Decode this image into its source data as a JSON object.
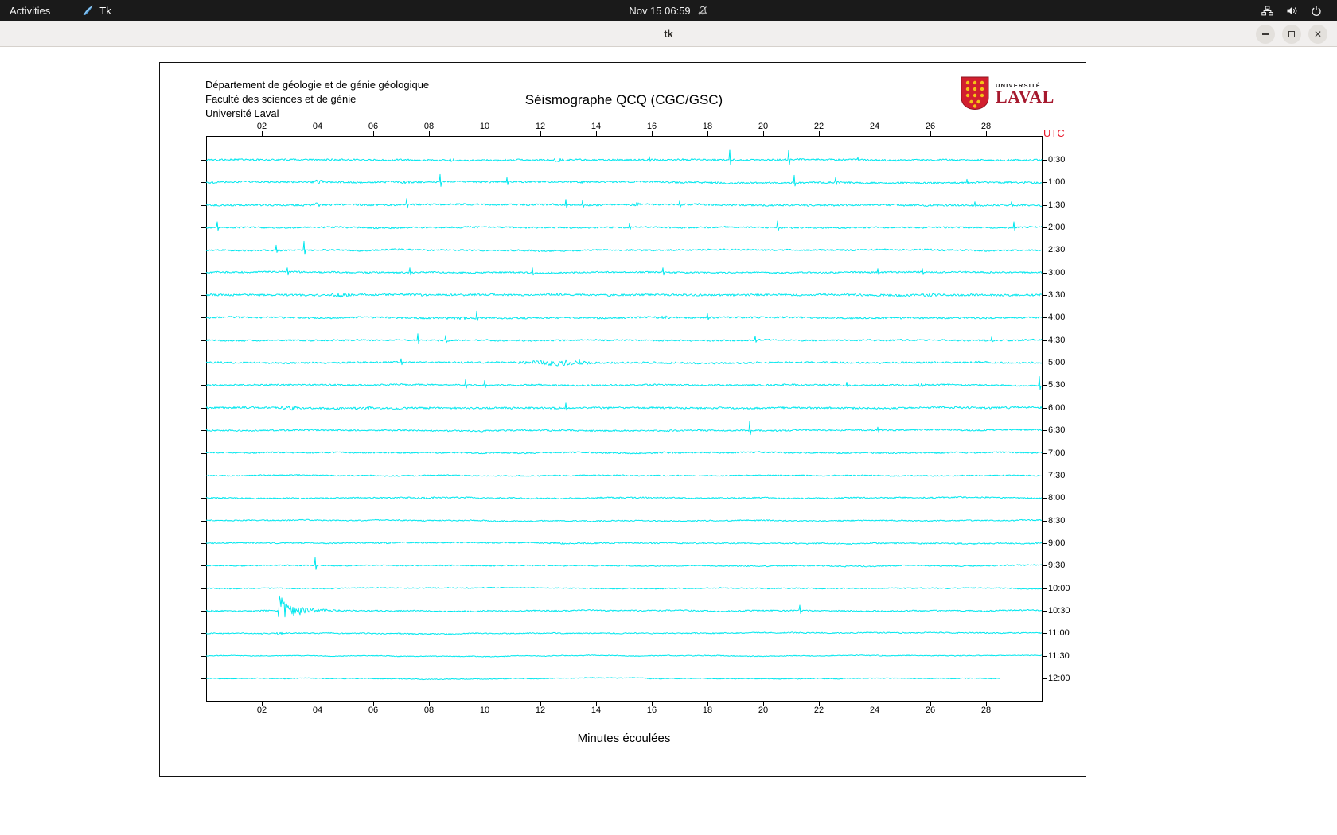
{
  "topbar": {
    "activities": "Activities",
    "app_name": "Tk",
    "clock": "Nov 15  06:59"
  },
  "titlebar": {
    "title": "tk"
  },
  "plot_header": {
    "line1": "Département de géologie et de génie géologique",
    "line2": "Faculté des sciences et de génie",
    "line3": "Université Laval"
  },
  "logo": {
    "small": "UNIVERSITÉ",
    "big": "LAVAL"
  },
  "colors": {
    "trace": "#00e7ee",
    "utc_red": "#e8192c",
    "logo_red": "#d21f2e",
    "logo_gold": "#f3c317"
  },
  "chart_data": {
    "type": "line",
    "title": "Séismographe QCQ (CGC/GSC)",
    "x_label": "Minutes écoulées",
    "utc_label": "UTC",
    "x_range": [
      0,
      30
    ],
    "minute_ticks": [
      "02",
      "04",
      "06",
      "08",
      "10",
      "12",
      "14",
      "16",
      "18",
      "20",
      "22",
      "24",
      "26",
      "28"
    ],
    "rows": [
      {
        "label": "0:30",
        "noise": 1.1,
        "events": [
          {
            "type": "blob",
            "t": 8.9,
            "a": 2,
            "w": 0.4
          },
          {
            "type": "blob",
            "t": 12.6,
            "a": 2.6,
            "w": 0.5
          },
          {
            "type": "spike",
            "t": 15.9,
            "a": 4
          },
          {
            "type": "spike",
            "t": 18.8,
            "a": 13
          },
          {
            "type": "spike",
            "t": 20.9,
            "a": 12
          },
          {
            "type": "spike",
            "t": 23.4,
            "a": 3
          }
        ]
      },
      {
        "label": "1:00",
        "noise": 1.1,
        "events": [
          {
            "type": "blob",
            "t": 4.0,
            "a": 2.6,
            "w": 0.5
          },
          {
            "type": "blob",
            "t": 7.2,
            "a": 2.6,
            "w": 0.4
          },
          {
            "type": "spike",
            "t": 8.4,
            "a": 10
          },
          {
            "type": "spike",
            "t": 10.8,
            "a": 6
          },
          {
            "type": "blob",
            "t": 13.5,
            "a": 2.4,
            "w": 0.3
          },
          {
            "type": "spike",
            "t": 21.1,
            "a": 9
          },
          {
            "type": "spike",
            "t": 22.6,
            "a": 6
          },
          {
            "type": "spike",
            "t": 27.3,
            "a": 4
          }
        ]
      },
      {
        "label": "1:30",
        "noise": 1.1,
        "events": [
          {
            "type": "blob",
            "t": 4.0,
            "a": 2.6,
            "w": 0.4
          },
          {
            "type": "spike",
            "t": 7.2,
            "a": 8
          },
          {
            "type": "spike",
            "t": 12.9,
            "a": 7
          },
          {
            "type": "spike",
            "t": 13.5,
            "a": 6
          },
          {
            "type": "blob",
            "t": 15.4,
            "a": 2.6,
            "w": 0.5
          },
          {
            "type": "spike",
            "t": 17.0,
            "a": 5
          },
          {
            "type": "spike",
            "t": 27.6,
            "a": 4
          },
          {
            "type": "spike",
            "t": 28.9,
            "a": 4
          }
        ]
      },
      {
        "label": "2:00",
        "noise": 1.0,
        "events": [
          {
            "type": "spike",
            "t": 0.4,
            "a": 7
          },
          {
            "type": "spike",
            "t": 15.2,
            "a": 5
          },
          {
            "type": "spike",
            "t": 20.5,
            "a": 8
          },
          {
            "type": "spike",
            "t": 29.0,
            "a": 7
          }
        ]
      },
      {
        "label": "2:30",
        "noise": 1.0,
        "events": [
          {
            "type": "spike",
            "t": 2.5,
            "a": 6
          },
          {
            "type": "spike",
            "t": 3.5,
            "a": 11
          }
        ]
      },
      {
        "label": "3:00",
        "noise": 1.0,
        "events": [
          {
            "type": "spike",
            "t": 2.9,
            "a": 6
          },
          {
            "type": "spike",
            "t": 7.3,
            "a": 6
          },
          {
            "type": "spike",
            "t": 11.7,
            "a": 6
          },
          {
            "type": "spike",
            "t": 16.4,
            "a": 6
          },
          {
            "type": "spike",
            "t": 24.1,
            "a": 5
          },
          {
            "type": "spike",
            "t": 25.7,
            "a": 5
          }
        ]
      },
      {
        "label": "3:30",
        "noise": 1.3,
        "events": [
          {
            "type": "blob",
            "t": 4.9,
            "a": 3,
            "w": 0.7
          },
          {
            "type": "blob",
            "t": 25.9,
            "a": 2.6,
            "w": 0.5
          }
        ]
      },
      {
        "label": "4:00",
        "noise": 1.1,
        "events": [
          {
            "type": "blob",
            "t": 9.0,
            "a": 2,
            "w": 1.2
          },
          {
            "type": "spike",
            "t": 9.7,
            "a": 8
          },
          {
            "type": "blob",
            "t": 16.5,
            "a": 2,
            "w": 1.0
          },
          {
            "type": "spike",
            "t": 18.0,
            "a": 5
          }
        ]
      },
      {
        "label": "4:30",
        "noise": 1.0,
        "events": [
          {
            "type": "spike",
            "t": 7.6,
            "a": 8
          },
          {
            "type": "spike",
            "t": 8.6,
            "a": 6
          },
          {
            "type": "spike",
            "t": 19.7,
            "a": 5
          },
          {
            "type": "spike",
            "t": 28.2,
            "a": 4
          }
        ]
      },
      {
        "label": "5:00",
        "noise": 1.1,
        "events": [
          {
            "type": "spike",
            "t": 7.0,
            "a": 5
          },
          {
            "type": "blob",
            "t": 12.6,
            "a": 3.5,
            "w": 2.4
          },
          {
            "type": "spike",
            "t": 13.4,
            "a": 4
          }
        ]
      },
      {
        "label": "5:30",
        "noise": 1.0,
        "events": [
          {
            "type": "spike",
            "t": 9.3,
            "a": 7
          },
          {
            "type": "spike",
            "t": 10.0,
            "a": 6
          },
          {
            "type": "spike",
            "t": 23.0,
            "a": 4
          },
          {
            "type": "blob",
            "t": 25.7,
            "a": 2.5,
            "w": 0.4
          },
          {
            "type": "spike",
            "t": 29.9,
            "a": 11
          }
        ]
      },
      {
        "label": "6:00",
        "noise": 1.2,
        "events": [
          {
            "type": "blob",
            "t": 3.0,
            "a": 3.5,
            "w": 0.5
          },
          {
            "type": "blob",
            "t": 5.8,
            "a": 2.5,
            "w": 0.3
          },
          {
            "type": "spike",
            "t": 12.9,
            "a": 6
          }
        ]
      },
      {
        "label": "6:30",
        "noise": 0.9,
        "events": [
          {
            "type": "spike",
            "t": 19.5,
            "a": 11
          },
          {
            "type": "spike",
            "t": 24.1,
            "a": 4
          }
        ]
      },
      {
        "label": "7:00",
        "noise": 0.9,
        "events": [
          {
            "type": "blob",
            "t": 16.5,
            "a": 1.5,
            "w": 0.8
          }
        ]
      },
      {
        "label": "7:30",
        "noise": 0.7,
        "events": []
      },
      {
        "label": "8:00",
        "noise": 0.8,
        "events": [
          {
            "type": "blob",
            "t": 7.9,
            "a": 1.5,
            "w": 1.0
          }
        ]
      },
      {
        "label": "8:30",
        "noise": 0.7,
        "events": []
      },
      {
        "label": "9:00",
        "noise": 0.8,
        "events": [
          {
            "type": "blob",
            "t": 6.5,
            "a": 1.3,
            "w": 0.8
          },
          {
            "type": "blob",
            "t": 12.5,
            "a": 1.3,
            "w": 1.2
          }
        ]
      },
      {
        "label": "9:30",
        "noise": 0.7,
        "events": [
          {
            "type": "spike",
            "t": 3.9,
            "a": 10
          }
        ]
      },
      {
        "label": "10:00",
        "noise": 0.6,
        "events": []
      },
      {
        "label": "10:30",
        "noise": 0.8,
        "events": [
          {
            "type": "quake",
            "t": 2.55,
            "a": 18,
            "coda": 3.5,
            "decay": 1.8
          },
          {
            "type": "spike",
            "t": 21.3,
            "a": 7
          }
        ]
      },
      {
        "label": "11:00",
        "noise": 0.7,
        "events": [
          {
            "type": "blob",
            "t": 2.7,
            "a": 2,
            "w": 0.5
          }
        ]
      },
      {
        "label": "11:30",
        "noise": 0.5,
        "events": []
      },
      {
        "label": "12:00",
        "noise": 0.5,
        "end": 28.5,
        "events": []
      }
    ]
  }
}
